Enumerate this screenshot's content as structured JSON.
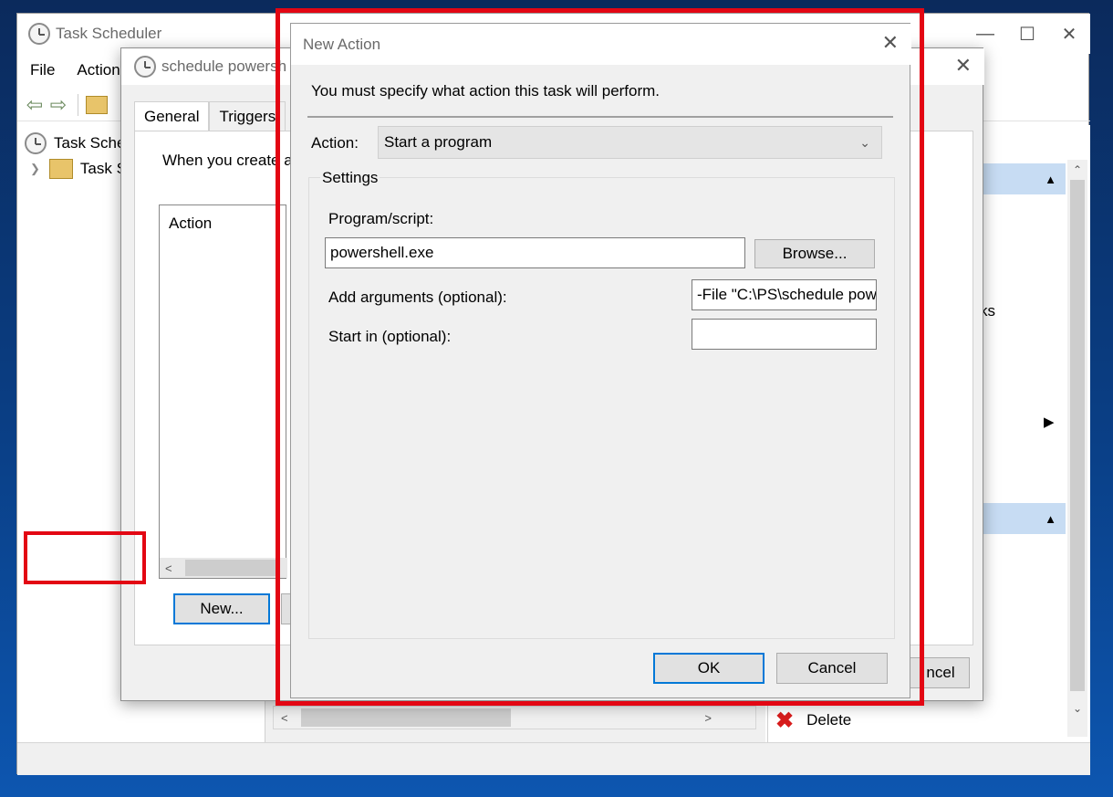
{
  "main_window": {
    "title": "Task Scheduler",
    "menu": [
      "File",
      "Action"
    ],
    "tree": [
      "Task Sche",
      "Task S"
    ],
    "right_pane": {
      "fragment_ks": "ks",
      "delete_label": "Delete",
      "cancel_fragment": "ncel"
    }
  },
  "task_dialog": {
    "title": "schedule powersh",
    "tabs": [
      "General",
      "Triggers"
    ],
    "description": "When you create a",
    "list_header": "Action",
    "new_button": "New..."
  },
  "new_action": {
    "title": "New Action",
    "instruction": "You must specify what action this task will perform.",
    "action_label": "Action:",
    "action_value": "Start a program",
    "settings_label": "Settings",
    "program_label": "Program/script:",
    "program_value": "powershell.exe",
    "browse_button": "Browse...",
    "arguments_label": "Add arguments (optional):",
    "arguments_value": "-File \"C:\\PS\\schedule pow",
    "start_in_label": "Start in (optional):",
    "start_in_value": "",
    "ok_button": "OK",
    "cancel_button": "Cancel"
  },
  "colors": {
    "highlight": "#e30613",
    "accent": "#0078d7",
    "selection_header": "#c7dcf3"
  }
}
